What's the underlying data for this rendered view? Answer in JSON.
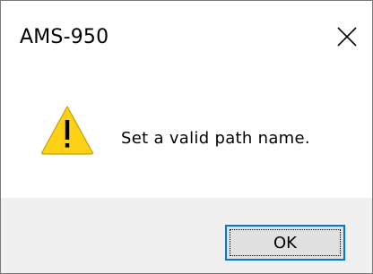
{
  "window": {
    "title": "AMS-950",
    "close_icon": "close-icon"
  },
  "message": {
    "icon": "warning-icon",
    "icon_color": "#fcd116",
    "text": "Set a valid path name."
  },
  "buttons": {
    "ok_label": "OK"
  },
  "colors": {
    "footer_bg": "#f0f0f0",
    "focus_border": "#0078d7",
    "button_bg": "#e1e1e1"
  }
}
